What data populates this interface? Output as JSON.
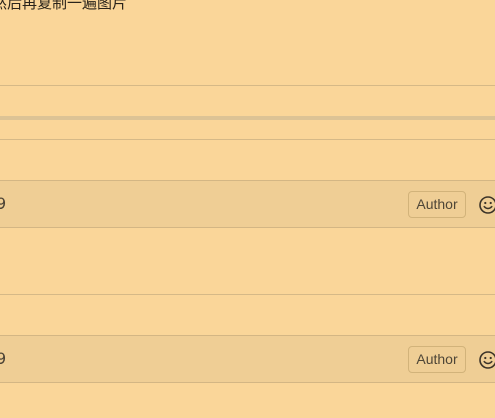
{
  "comment_top": {
    "body_text": "然后再复制一遍图片"
  },
  "comments": [
    {
      "timestamp": "9",
      "badge": "Author",
      "reaction_icon": "smiley-icon"
    },
    {
      "timestamp": "9",
      "badge": "Author",
      "reaction_icon": "smiley-icon"
    }
  ],
  "colors": {
    "page_background": "#fad699",
    "header_background": "#efce95",
    "divider": "#d5b987"
  }
}
